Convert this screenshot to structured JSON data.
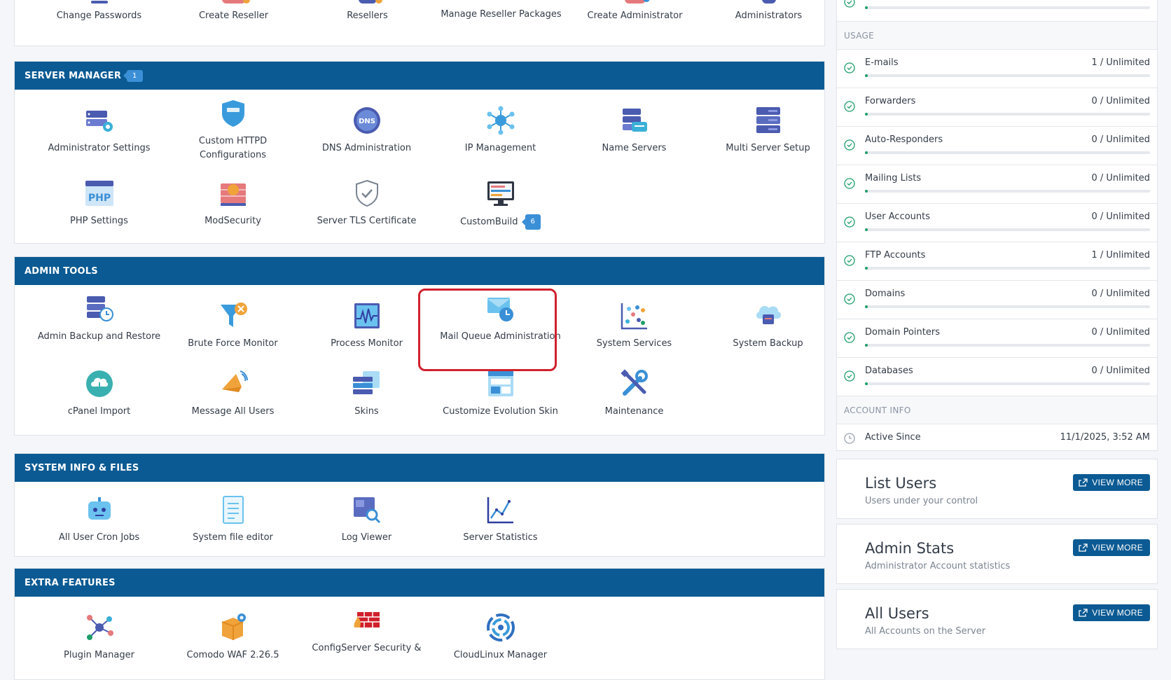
{
  "top_row": [
    {
      "label": "Change Passwords"
    },
    {
      "label": "Create Reseller"
    },
    {
      "label": "Resellers"
    },
    {
      "label": "Manage Reseller Packages"
    },
    {
      "label": "Create Administrator"
    },
    {
      "label": "Administrators"
    }
  ],
  "server_manager": {
    "title": "SERVER MANAGER",
    "badge": "1",
    "items": [
      {
        "label": "Administrator Settings",
        "icon": "server-gear-icon"
      },
      {
        "label": "Custom HTTPD Configurations",
        "icon": "httpd-shield-icon"
      },
      {
        "label": "DNS Administration",
        "icon": "dns-globe-icon"
      },
      {
        "label": "IP Management",
        "icon": "network-node-icon"
      },
      {
        "label": "Name Servers",
        "icon": "server-chat-icon"
      },
      {
        "label": "Multi Server Setup",
        "icon": "server-stack-icon"
      },
      {
        "label": "PHP Settings",
        "icon": "php-window-icon"
      },
      {
        "label": "ModSecurity",
        "icon": "firewall-shield-icon"
      },
      {
        "label": "Server TLS Certificate",
        "icon": "shield-check-icon"
      },
      {
        "label": "CustomBuild",
        "icon": "monitor-icon",
        "badge": "6"
      }
    ]
  },
  "admin_tools": {
    "title": "ADMIN TOOLS",
    "items": [
      {
        "label": "Admin Backup and Restore",
        "icon": "server-clock-icon"
      },
      {
        "label": "Brute Force Monitor",
        "icon": "funnel-icon"
      },
      {
        "label": "Process Monitor",
        "icon": "pulse-monitor-icon"
      },
      {
        "label": "Mail Queue Administration",
        "icon": "mail-clock-icon"
      },
      {
        "label": "System Services",
        "icon": "scatter-icon"
      },
      {
        "label": "System Backup",
        "icon": "cloud-server-icon"
      },
      {
        "label": "cPanel Import",
        "icon": "cloud-download-icon"
      },
      {
        "label": "Message All Users",
        "icon": "megaphone-icon"
      },
      {
        "label": "Skins",
        "icon": "skins-layers-icon"
      },
      {
        "label": "Customize Evolution Skin",
        "icon": "layout-icon"
      },
      {
        "label": "Maintenance",
        "icon": "wrench-screwdriver-icon"
      }
    ]
  },
  "system_info": {
    "title": "SYSTEM INFO & FILES",
    "items": [
      {
        "label": "All User Cron Jobs",
        "icon": "robot-icon"
      },
      {
        "label": "System file editor",
        "icon": "document-icon"
      },
      {
        "label": "Log Viewer",
        "icon": "log-search-icon"
      },
      {
        "label": "Server Statistics",
        "icon": "line-chart-icon"
      }
    ]
  },
  "extra_features": {
    "title": "EXTRA FEATURES",
    "items": [
      {
        "label": "Plugin Manager",
        "icon": "plugin-nodes-icon"
      },
      {
        "label": "Comodo WAF 2.26.5",
        "icon": "box-gear-icon"
      },
      {
        "label": "ConfigServer Security &",
        "icon": "brick-fire-icon"
      },
      {
        "label": "CloudLinux Manager",
        "icon": "swirl-icon"
      }
    ]
  },
  "sidebar": {
    "usage_title": "USAGE",
    "usage": [
      {
        "label": "E-mails",
        "value": "1 / Unlimited"
      },
      {
        "label": "Forwarders",
        "value": "0 / Unlimited"
      },
      {
        "label": "Auto-Responders",
        "value": "0 / Unlimited"
      },
      {
        "label": "Mailing Lists",
        "value": "0 / Unlimited"
      },
      {
        "label": "User Accounts",
        "value": "0 / Unlimited"
      },
      {
        "label": "FTP Accounts",
        "value": "1 / Unlimited"
      },
      {
        "label": "Domains",
        "value": "0 / Unlimited"
      },
      {
        "label": "Domain Pointers",
        "value": "0 / Unlimited"
      },
      {
        "label": "Databases",
        "value": "0 / Unlimited"
      }
    ],
    "account_title": "ACCOUNT INFO",
    "active_since_label": "Active Since",
    "active_since_value": "11/1/2025, 3:52 AM"
  },
  "cards": [
    {
      "title": "List Users",
      "subtitle": "Users under your control",
      "button": "VIEW MORE"
    },
    {
      "title": "Admin Stats",
      "subtitle": "Administrator Account statistics",
      "button": "VIEW MORE"
    },
    {
      "title": "All Users",
      "subtitle": "All Accounts on the Server",
      "button": "VIEW MORE"
    }
  ],
  "colors": {
    "header": "#0b5a93",
    "badge": "#3a8fd6",
    "highlight": "#d0212d",
    "progress": "#1d9e6a"
  }
}
